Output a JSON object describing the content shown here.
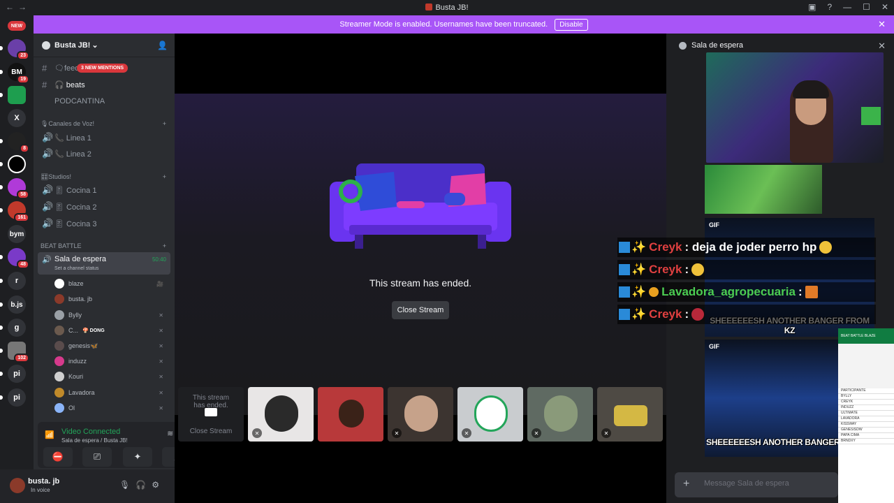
{
  "window": {
    "title": "Busta JB!",
    "back": "←",
    "forward": "→"
  },
  "banner": {
    "text": "Streamer Mode is enabled. Usernames have been truncated.",
    "disable": "Disable",
    "close": "✕"
  },
  "servers": {
    "new_label": "NEW",
    "badges": [
      "23",
      "19",
      "8",
      "58",
      "161",
      "48",
      "102"
    ],
    "letters": [
      "X",
      "bym",
      "r",
      "b.js",
      "g",
      "pi",
      "pi"
    ],
    "bm": "BM"
  },
  "guild": {
    "name": "Busta JB!",
    "chevron": "⌄"
  },
  "channels": {
    "mentions_pill": "3 NEW MENTIONS",
    "text": [
      {
        "label": "🗨feedb",
        "icon": "#"
      },
      {
        "label": "🎧 beats",
        "icon": "#"
      },
      {
        "label": "PODCANTINA",
        "icon": ""
      }
    ],
    "voice_cat": "🎙Canales de Voz!",
    "voice": [
      "📞 Linea 1",
      "📞 Linea 2"
    ],
    "studios_cat": "🎛Studios!",
    "studios": [
      "🎚 Cocina 1",
      "🎚 Cocina 2",
      "🎚 Cocina 3"
    ],
    "beat_cat": "BEAT BATTLE",
    "active": {
      "name": "Sala de espera",
      "status": "Set a channel status",
      "time": "50:40"
    },
    "users": [
      {
        "name": "blaze",
        "color": "#ffffff"
      },
      {
        "name": "busta. jb",
        "color": "#8b3a2a"
      },
      {
        "name": "Bylly",
        "color": "#9aa0a6"
      },
      {
        "name": "C...",
        "color": "#6b5a4e",
        "extra": "🍄 DONG"
      },
      {
        "name": "genesis🦋",
        "color": "#5a4c4c"
      },
      {
        "name": "induzz",
        "color": "#d63a8c"
      },
      {
        "name": "Kouri",
        "color": "#cfcfcf"
      },
      {
        "name": "Lavadora",
        "color": "#c08a2a"
      },
      {
        "name": "Ol",
        "color": "#8ab4f8"
      }
    ]
  },
  "voice_panel": {
    "status": "Video Connected",
    "sub": "Sala de espera / Busta JB!"
  },
  "user": {
    "name": "busta. jb",
    "status": "In voice"
  },
  "stream": {
    "ended": "This stream has ended.",
    "close": "Close Stream"
  },
  "tiles": {
    "first_text": "This stream has ended.",
    "first_btn": "Close Stream"
  },
  "right": {
    "title": "Sala de espera",
    "gif_label": "GIF",
    "caption": "SHEEEEEESH ANOTHER BANGER FROM KZ",
    "caption2": "SHEEEEEESH ANOTHER BANGER",
    "placeholder": "Message Sala de espera"
  },
  "overlay": {
    "lines": [
      {
        "user": "Creyk",
        "text": ": deja de joder perro hp"
      },
      {
        "user": "Creyk",
        "text": ":"
      },
      {
        "user": "Lavadora_agropecuaria",
        "text": ":"
      },
      {
        "user": "Creyk",
        "text": ":"
      }
    ]
  },
  "sheet": {
    "title": "BEAT BATTLE BLAZE",
    "rows": [
      "PARTICIPANTE",
      "BYLLY",
      "CREYK",
      "INDUZZ",
      "ULTIMATE",
      "LAVADORA",
      "KISSWAY",
      "GENESISDW",
      "PAPA CIMA",
      "BRNDXY"
    ]
  },
  "colors": {
    "accent": "#a855f7",
    "green": "#23a55a",
    "red": "#da373c"
  }
}
